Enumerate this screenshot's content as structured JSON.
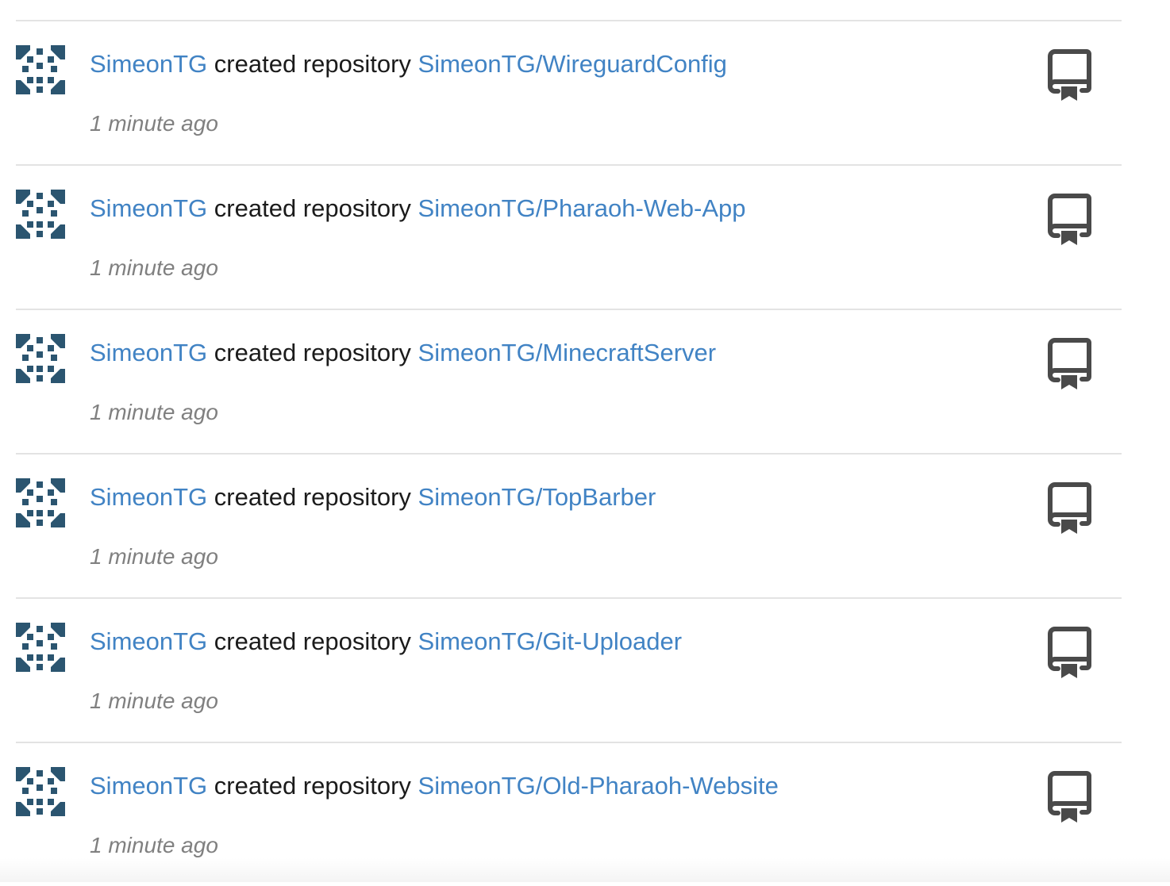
{
  "feed": {
    "items": [
      {
        "user": "SimeonTG",
        "action": "created repository",
        "repo": "SimeonTG/WireguardConfig",
        "time": "1 minute ago",
        "avatar_icon": "identicon-avatar",
        "type_icon": "repo-icon"
      },
      {
        "user": "SimeonTG",
        "action": "created repository",
        "repo": "SimeonTG/Pharaoh-Web-App",
        "time": "1 minute ago",
        "avatar_icon": "identicon-avatar",
        "type_icon": "repo-icon"
      },
      {
        "user": "SimeonTG",
        "action": "created repository",
        "repo": "SimeonTG/MinecraftServer",
        "time": "1 minute ago",
        "avatar_icon": "identicon-avatar",
        "type_icon": "repo-icon"
      },
      {
        "user": "SimeonTG",
        "action": "created repository",
        "repo": "SimeonTG/TopBarber",
        "time": "1 minute ago",
        "avatar_icon": "identicon-avatar",
        "type_icon": "repo-icon"
      },
      {
        "user": "SimeonTG",
        "action": "created repository",
        "repo": "SimeonTG/Git-Uploader",
        "time": "1 minute ago",
        "avatar_icon": "identicon-avatar",
        "type_icon": "repo-icon"
      },
      {
        "user": "SimeonTG",
        "action": "created repository",
        "repo": "SimeonTG/Old-Pharaoh-Website",
        "time": "1 minute ago",
        "avatar_icon": "identicon-avatar",
        "type_icon": "repo-icon"
      }
    ]
  },
  "colors": {
    "link": "#4183c4",
    "text": "#1b1b1b",
    "muted": "#808080",
    "avatar": "#2b5570",
    "icon": "#4a4a4a",
    "divider": "#e3e3e3"
  }
}
